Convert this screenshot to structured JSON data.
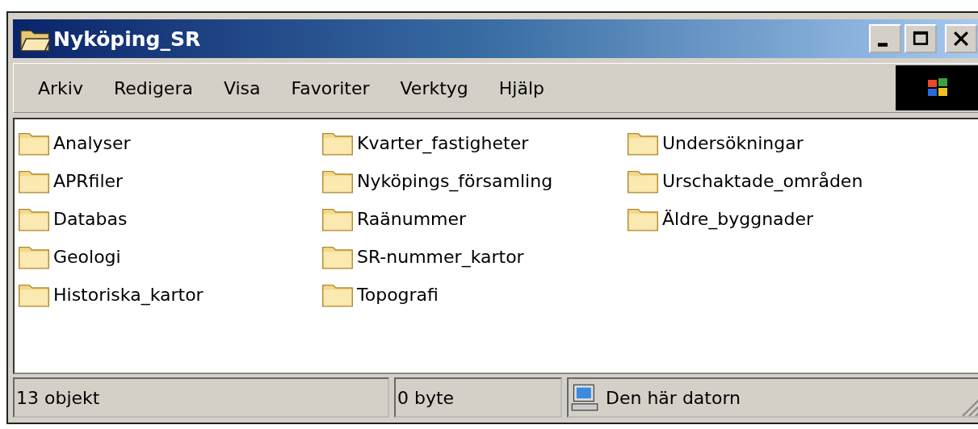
{
  "window": {
    "title": "Nyköping_SR"
  },
  "menu": [
    {
      "label": "Arkiv"
    },
    {
      "label": "Redigera"
    },
    {
      "label": "Visa"
    },
    {
      "label": "Favoriter"
    },
    {
      "label": "Verktyg"
    },
    {
      "label": "Hjälp"
    }
  ],
  "folders": [
    [
      "Analyser",
      "APRfiler",
      "Databas",
      "Geologi",
      "Historiska_kartor"
    ],
    [
      "Kvarter_fastigheter",
      "Nyköpings_församling",
      "Raänummer",
      "SR-nummer_kartor",
      "Topografi"
    ],
    [
      "Undersökningar",
      "Urschaktade_områden",
      "Äldre_byggnader"
    ]
  ],
  "status_bar": {
    "count": "13 objekt",
    "size": "0 byte",
    "location": "Den här datorn"
  }
}
